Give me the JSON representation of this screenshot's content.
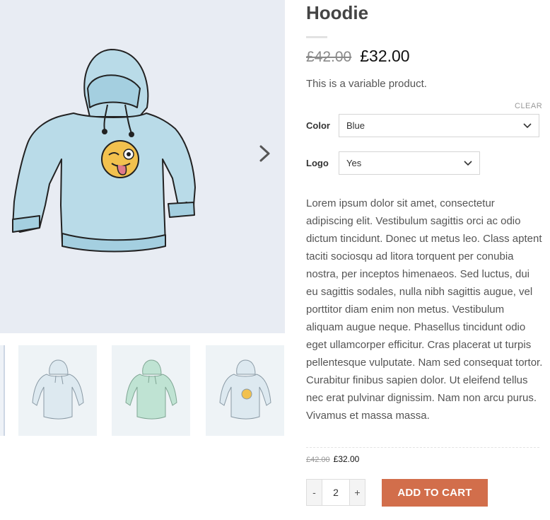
{
  "gallery": {
    "main_image_icon": "hoodie-image",
    "next_icon": "chevron-right-icon",
    "thumbnails": [
      "hoodie-blue-thumb",
      "hoodie-green-thumb",
      "hoodie-logo-thumb"
    ]
  },
  "product": {
    "title": "Hoodie",
    "old_price": "£42.00",
    "price": "£32.00",
    "short_description": "This is a variable product.",
    "clear_label": "CLEAR",
    "variations": [
      {
        "label": "Color",
        "selected": "Blue"
      },
      {
        "label": "Logo",
        "selected": "Yes"
      }
    ],
    "description": "Lorem ipsum dolor sit amet, consectetur adipiscing elit. Vestibulum sagittis orci ac odio dictum tincidunt. Donec ut metus leo. Class aptent taciti sociosqu ad litora torquent per conubia nostra, per inceptos himenaeos. Sed luctus, dui eu sagittis sodales, nulla nibh sagittis augue, vel porttitor diam enim non metus. Vestibulum aliquam augue neque. Phasellus tincidunt odio eget ullamcorper efficitur. Cras placerat ut turpis pellentesque vulputate. Nam sed consequat tortor. Curabitur finibus sapien dolor. Ut eleifend tellus nec erat pulvinar dignissim. Nam non arcu purus. Vivamus et massa massa.",
    "variation_old_price": "£42.00",
    "variation_price": "£32.00"
  },
  "cart": {
    "minus_label": "-",
    "quantity": "2",
    "plus_label": "+",
    "add_to_cart_label": "ADD TO CART"
  },
  "colors": {
    "accent": "#d26e4b",
    "hoodie_blue": "#b9dbe8",
    "hoodie_green": "#bfe3d3",
    "emoji_yellow": "#f2c14e",
    "gallery_bg": "#e8ecf3"
  }
}
